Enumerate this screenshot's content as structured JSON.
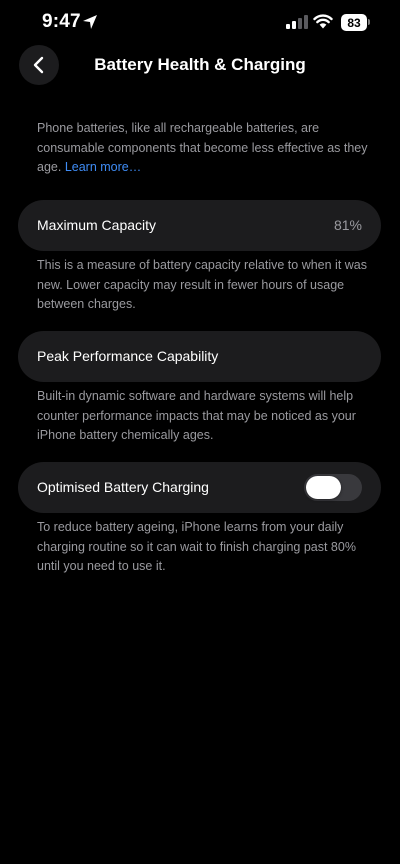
{
  "status_bar": {
    "time": "9:47",
    "battery_level": "83"
  },
  "nav": {
    "title": "Battery Health & Charging"
  },
  "intro": {
    "text": "Phone batteries, like all rechargeable batteries, are consumable components that become less effective as they age. ",
    "link_label": "Learn more…"
  },
  "maximum_capacity": {
    "label": "Maximum Capacity",
    "value": "81%",
    "footnote": "This is a measure of battery capacity relative to when it was new. Lower capacity may result in fewer hours of usage between charges."
  },
  "peak_performance": {
    "label": "Peak Performance Capability",
    "footnote": "Built-in dynamic software and hardware systems will help counter performance impacts that may be noticed as your iPhone battery chemically ages."
  },
  "optimised_charging": {
    "label": "Optimised Battery Charging",
    "enabled": false,
    "footnote": "To reduce battery ageing, iPhone learns from your daily charging routine so it can wait to finish charging past 80% until you need to use it."
  },
  "colors": {
    "background": "#000000",
    "cell": "#1c1c1e",
    "secondary_text": "#9a9a9f",
    "link": "#3f8cf5",
    "toggle_off": "#39393d"
  },
  "icons": {
    "location": "location-arrow-icon",
    "signal": "cellular-signal-icon",
    "wifi": "wifi-icon",
    "battery": "battery-icon",
    "back": "chevron-left-icon"
  }
}
